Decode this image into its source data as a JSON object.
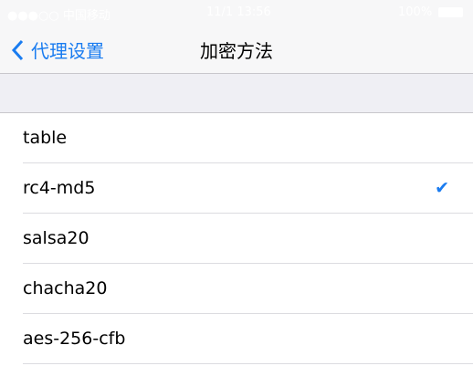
{
  "status_bar": {
    "carrier": "●●●○○ 中国移动",
    "time": "11/1 13:56",
    "battery": "100%"
  },
  "nav": {
    "back_label": "代理设置",
    "title": "加密方法"
  },
  "methods": [
    {
      "label": "table",
      "selected": false
    },
    {
      "label": "rc4-md5",
      "selected": true
    },
    {
      "label": "salsa20",
      "selected": false
    },
    {
      "label": "chacha20",
      "selected": false
    },
    {
      "label": "aes-256-cfb",
      "selected": false
    }
  ],
  "colors": {
    "accent": "#1a7cf0"
  }
}
